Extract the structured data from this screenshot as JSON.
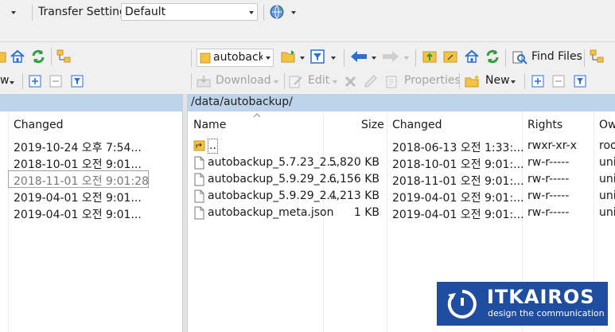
{
  "toolbar": {
    "transfer_settings_label": "Transfer Settings",
    "transfer_settings_value": "Default"
  },
  "right_toolbar": {
    "path_dropdown_value": "autobackup",
    "find_files_label": "Find Files",
    "download_label": "Download",
    "edit_label": "Edit",
    "properties_label": "Properties",
    "new_label": "New"
  },
  "left_panel": {
    "columns": [
      "Changed"
    ],
    "rows": [
      {
        "changed": "2019-10-24  오후 7:54..."
      },
      {
        "changed": "2018-10-01  오전 9:01..."
      },
      {
        "changed": "2018-11-01  오전 9:01:28"
      },
      {
        "changed": "2019-04-01  오전 9:01..."
      },
      {
        "changed": "2019-04-01  오전 9:01..."
      }
    ]
  },
  "right_panel": {
    "path": "/data/autobackup/",
    "columns": {
      "name": "Name",
      "size": "Size",
      "changed": "Changed",
      "rights": "Rights",
      "owner": "Ow"
    },
    "rows": [
      {
        "name": "..",
        "size": "",
        "changed": "2018-06-13  오전 1:33:...",
        "rights": "rwxr-xr-x",
        "owner": "roo"
      },
      {
        "name": "autobackup_5.7.23_2...",
        "size": "5,820 KB",
        "changed": "2018-10-01  오전 9:01:...",
        "rights": "rw-r-----",
        "owner": "uni"
      },
      {
        "name": "autobackup_5.9.29_2...",
        "size": "6,156 KB",
        "changed": "2018-11-01  오전 9:01:...",
        "rights": "rw-r-----",
        "owner": "uni"
      },
      {
        "name": "autobackup_5.9.29_2...",
        "size": "4,213 KB",
        "changed": "2019-04-01  오전 9:01:...",
        "rights": "rw-r-----",
        "owner": "uni"
      },
      {
        "name": "autobackup_meta.json",
        "size": "1 KB",
        "changed": "2019-04-01  오전 9:01:...",
        "rights": "rw-r-----",
        "owner": "uni"
      }
    ]
  },
  "logo": {
    "brand": "ITKAIROS",
    "tagline": "design the communication"
  },
  "colors": {
    "path_bar": "#bcd3ea",
    "logo_bg": "#1f4ea0",
    "folder_yellow": "#f5c342",
    "green_refresh": "#2e9e3a",
    "blue_arrow": "#2b6fd1"
  }
}
